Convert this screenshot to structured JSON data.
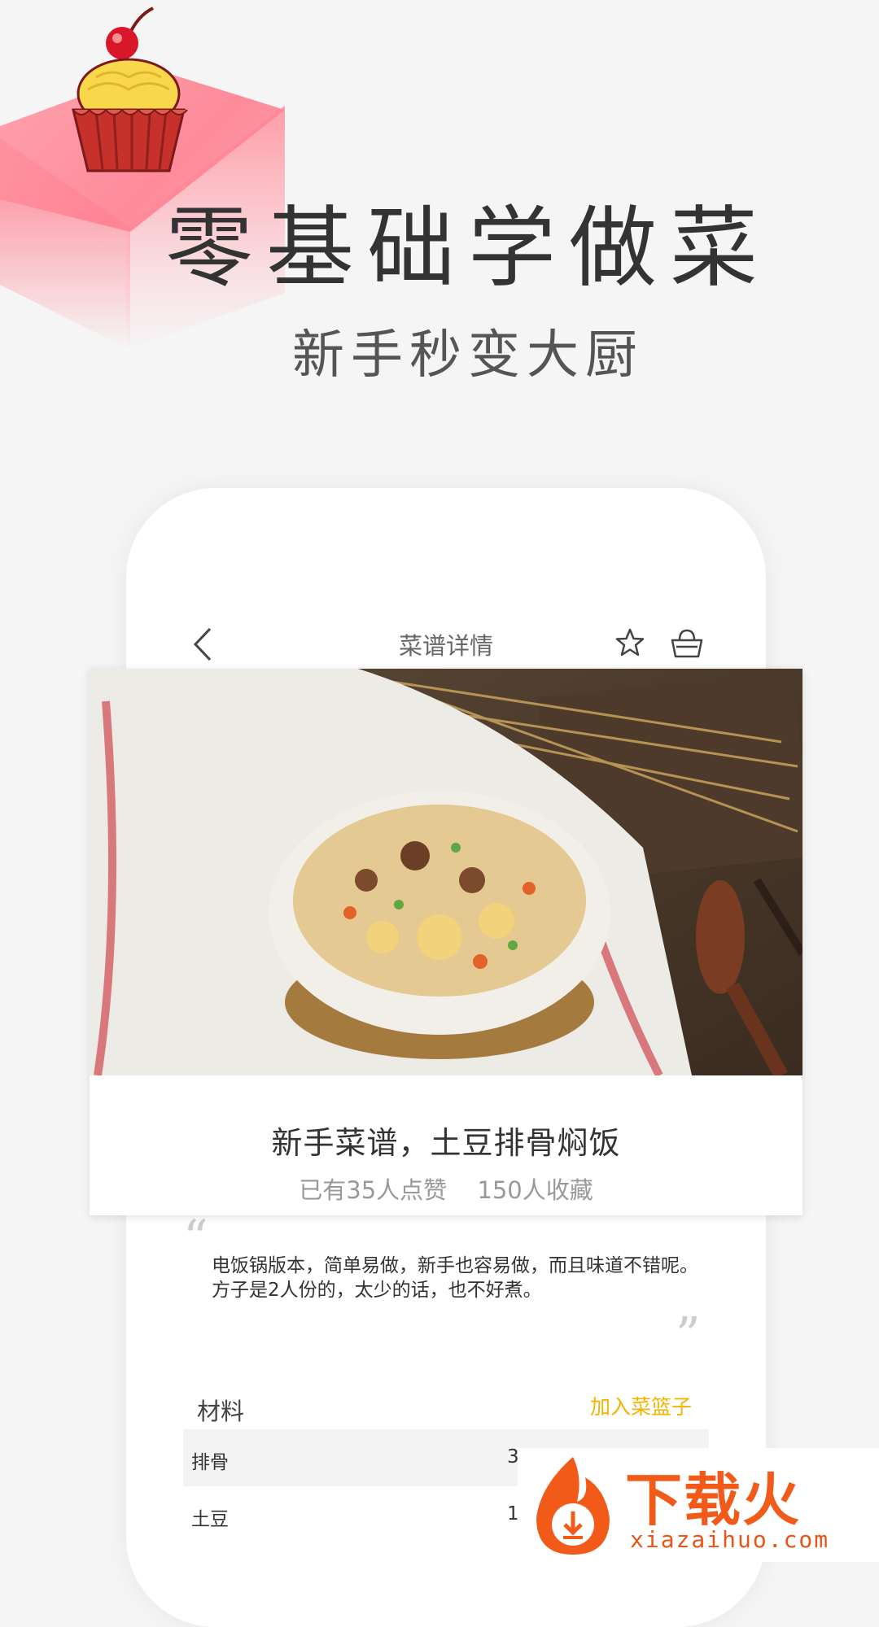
{
  "hero": {
    "title": "零基础学做菜",
    "subtitle": "新手秒变大厨"
  },
  "nav": {
    "title": "菜谱详情",
    "icons": [
      "back-arrow-icon",
      "star-icon",
      "basket-icon"
    ]
  },
  "recipe": {
    "title": "新手菜谱，土豆排骨焖饭",
    "likes": "已有35人点赞",
    "favorites": "150人收藏",
    "description": "电饭锅版本，简单易做，新手也容易做，而且味道不错呢。方子是2人份的，太少的话，也不好煮。"
  },
  "quotes": {
    "open": "“",
    "close": "”"
  },
  "materials": {
    "label": "材料",
    "add_to_basket": "加入菜篮子",
    "items": [
      {
        "name": "排骨",
        "qty": "3"
      },
      {
        "name": "土豆",
        "qty": "1"
      }
    ]
  },
  "watermark": {
    "brand": "下载火",
    "url": "xiazaihuo.com"
  },
  "colors": {
    "accent": "#f5b300",
    "cube_pink": "#ff7f90",
    "watermark_orange": "#f25a1a"
  }
}
